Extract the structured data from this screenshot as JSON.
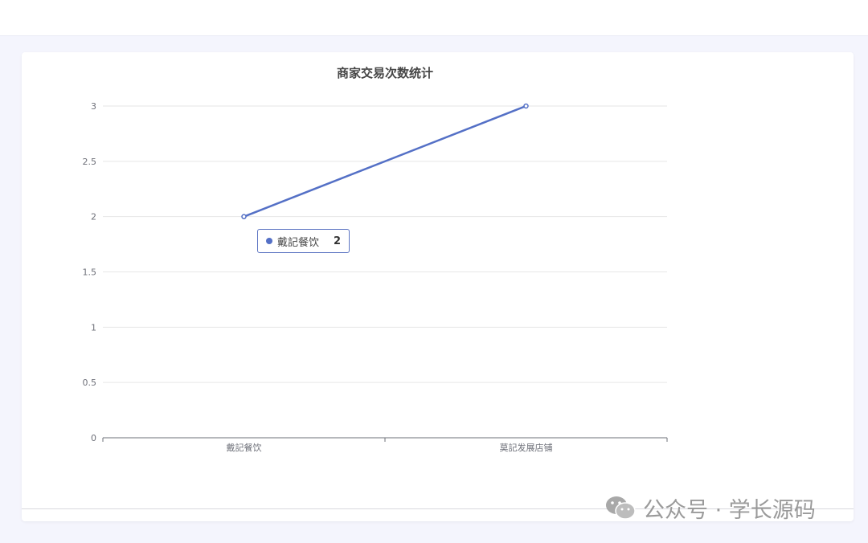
{
  "chart_data": {
    "type": "line",
    "title": "商家交易次数统计",
    "categories": [
      "戴記餐饮",
      "莫記发展店铺"
    ],
    "series": [
      {
        "values": [
          2,
          3
        ]
      }
    ],
    "ylim": [
      0,
      3
    ],
    "yticks": [
      "0",
      "0.5",
      "1",
      "1.5",
      "2",
      "2.5",
      "3"
    ],
    "grid": true,
    "line_color": "#5470c6"
  },
  "tooltip": {
    "label": "戴記餐饮",
    "value": "2",
    "color": "#5470c6"
  },
  "watermark": {
    "text": "公众号 · 学长源码",
    "icon": "wechat-icon"
  }
}
